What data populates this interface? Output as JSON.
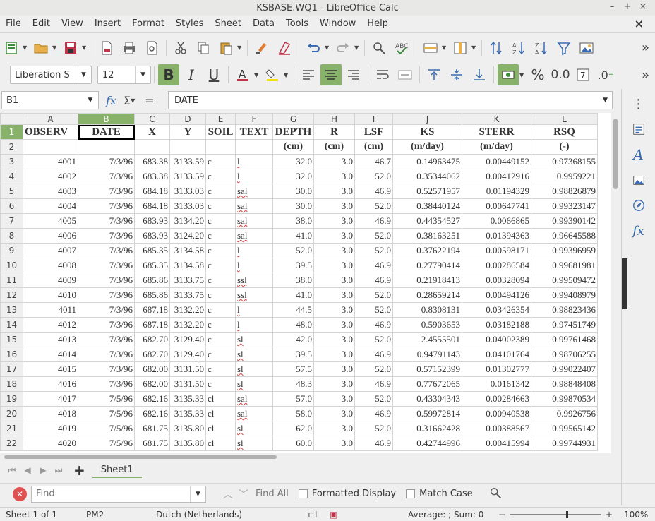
{
  "window": {
    "title": "KSBASE.WQ1 - LibreOffice Calc"
  },
  "menu": [
    "File",
    "Edit",
    "View",
    "Insert",
    "Format",
    "Styles",
    "Sheet",
    "Data",
    "Tools",
    "Window",
    "Help"
  ],
  "formatting": {
    "font_name": "Liberation S",
    "font_size": "12"
  },
  "formula_bar": {
    "cell_ref": "B1",
    "content": "DATE"
  },
  "columns": [
    "A",
    "B",
    "C",
    "D",
    "E",
    "F",
    "G",
    "H",
    "I",
    "J",
    "K",
    "L"
  ],
  "header_row": [
    "OBSERV",
    "DATE",
    "X",
    "Y",
    "SOIL",
    "TEXT",
    "DEPTH",
    "R",
    "LSF",
    "KS",
    "STERR",
    "RSQ"
  ],
  "unit_row": [
    "",
    "",
    "",
    "",
    "",
    "",
    "(cm)",
    "(cm)",
    "(cm)",
    "(m/day)",
    "(m/day)",
    "(-)"
  ],
  "rows": [
    [
      "4001",
      "7/3/96",
      "683.38",
      "3133.59",
      "c",
      "l",
      "32.0",
      "3.0",
      "46.7",
      "0.14963475",
      "0.00449152",
      "0.97368155"
    ],
    [
      "4002",
      "7/3/96",
      "683.38",
      "3133.59",
      "c",
      "l",
      "32.0",
      "3.0",
      "52.0",
      "0.35344062",
      "0.00412916",
      "0.9959221"
    ],
    [
      "4003",
      "7/3/96",
      "684.18",
      "3133.03",
      "c",
      "sal",
      "30.0",
      "3.0",
      "46.9",
      "0.52571957",
      "0.01194329",
      "0.98826879"
    ],
    [
      "4004",
      "7/3/96",
      "684.18",
      "3133.03",
      "c",
      "sal",
      "30.0",
      "3.0",
      "52.0",
      "0.38440124",
      "0.00647741",
      "0.99323147"
    ],
    [
      "4005",
      "7/3/96",
      "683.93",
      "3134.20",
      "c",
      "sal",
      "38.0",
      "3.0",
      "46.9",
      "0.44354527",
      "0.0066865",
      "0.99390142"
    ],
    [
      "4006",
      "7/3/96",
      "683.93",
      "3124.20",
      "c",
      "sal",
      "41.0",
      "3.0",
      "52.0",
      "0.38163251",
      "0.01394363",
      "0.96645588"
    ],
    [
      "4007",
      "7/3/96",
      "685.35",
      "3134.58",
      "c",
      "l",
      "52.0",
      "3.0",
      "52.0",
      "0.37622194",
      "0.00598171",
      "0.99396959"
    ],
    [
      "4008",
      "7/3/96",
      "685.35",
      "3134.58",
      "c",
      "l",
      "39.5",
      "3.0",
      "46.9",
      "0.27790414",
      "0.00286584",
      "0.99681981"
    ],
    [
      "4009",
      "7/3/96",
      "685.86",
      "3133.75",
      "c",
      "ssl",
      "38.0",
      "3.0",
      "46.9",
      "0.21918413",
      "0.00328094",
      "0.99509472"
    ],
    [
      "4010",
      "7/3/96",
      "685.86",
      "3133.75",
      "c",
      "ssl",
      "41.0",
      "3.0",
      "52.0",
      "0.28659214",
      "0.00494126",
      "0.99408979"
    ],
    [
      "4011",
      "7/3/96",
      "687.18",
      "3132.20",
      "c",
      "l",
      "44.5",
      "3.0",
      "52.0",
      "0.8308131",
      "0.03426354",
      "0.98823436"
    ],
    [
      "4012",
      "7/3/96",
      "687.18",
      "3132.20",
      "c",
      "l",
      "48.0",
      "3.0",
      "46.9",
      "0.5903653",
      "0.03182188",
      "0.97451749"
    ],
    [
      "4013",
      "7/3/96",
      "682.70",
      "3129.40",
      "c",
      "sl",
      "42.0",
      "3.0",
      "52.0",
      "2.4555501",
      "0.04002389",
      "0.99761468"
    ],
    [
      "4014",
      "7/3/96",
      "682.70",
      "3129.40",
      "c",
      "sl",
      "39.5",
      "3.0",
      "46.9",
      "0.94791143",
      "0.04101764",
      "0.98706255"
    ],
    [
      "4015",
      "7/3/96",
      "682.00",
      "3131.50",
      "c",
      "sl",
      "57.5",
      "3.0",
      "52.0",
      "0.57152399",
      "0.01302777",
      "0.99022407"
    ],
    [
      "4016",
      "7/3/96",
      "682.00",
      "3131.50",
      "c",
      "sl",
      "48.3",
      "3.0",
      "46.9",
      "0.77672065",
      "0.0161342",
      "0.98848408"
    ],
    [
      "4017",
      "7/5/96",
      "682.16",
      "3135.33",
      "cl",
      "sal",
      "57.0",
      "3.0",
      "52.0",
      "0.43304343",
      "0.00284663",
      "0.99870534"
    ],
    [
      "4018",
      "7/5/96",
      "682.16",
      "3135.33",
      "cl",
      "sal",
      "58.0",
      "3.0",
      "46.9",
      "0.59972814",
      "0.00940538",
      "0.9926756"
    ],
    [
      "4019",
      "7/5/96",
      "681.75",
      "3135.80",
      "cl",
      "sl",
      "62.0",
      "3.0",
      "52.0",
      "0.31662428",
      "0.00388567",
      "0.99565142"
    ],
    [
      "4020",
      "7/5/96",
      "681.75",
      "3135.80",
      "cl",
      "sl",
      "60.0",
      "3.0",
      "46.9",
      "0.42744996",
      "0.00415994",
      "0.99744931"
    ]
  ],
  "tabs": {
    "sheet": "Sheet1"
  },
  "find": {
    "placeholder": "Find",
    "find_all": "Find All",
    "formatted_display": "Formatted Display",
    "match_case": "Match Case"
  },
  "status": {
    "sheet": "Sheet 1 of 1",
    "style": "PM2",
    "language": "Dutch (Netherlands)",
    "summary": "Average: ; Sum: 0",
    "zoom": "100%"
  },
  "colors": {
    "accent": "#88b26a",
    "grid": "#d4d4d4"
  }
}
